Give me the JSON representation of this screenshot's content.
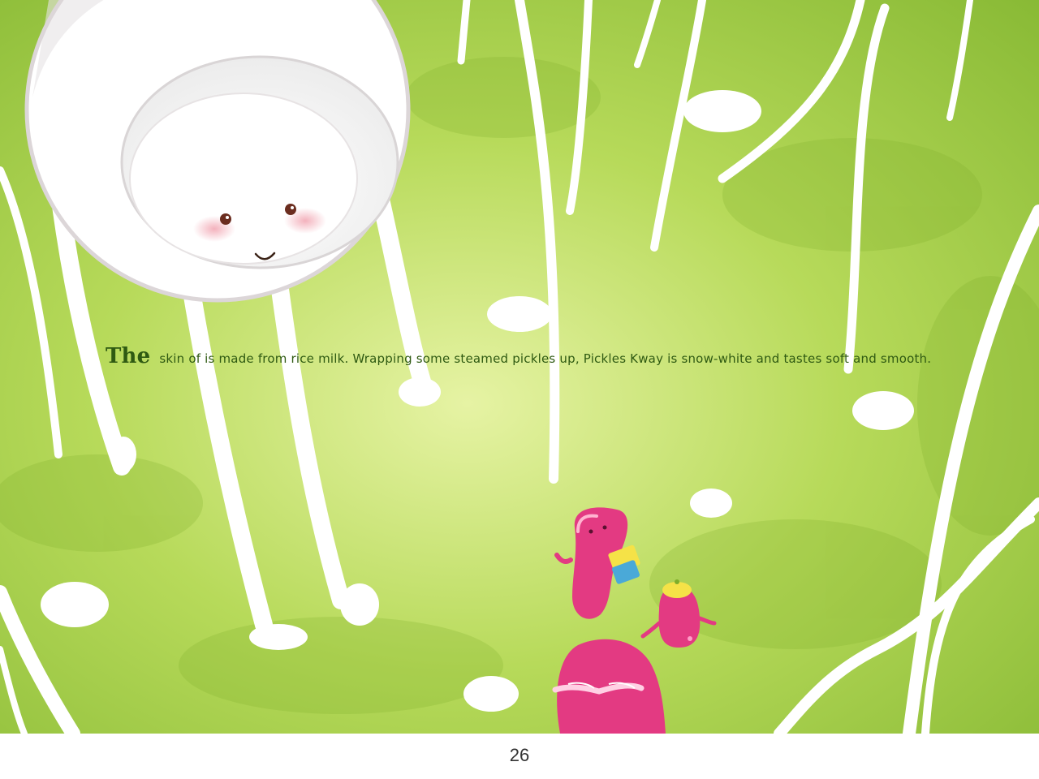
{
  "story": {
    "caption_first_word": "The",
    "caption_rest": "skin of is made from  rice milk. Wrapping some steamed pickles up, Pickles Kway is snow-white and tastes soft and smooth."
  },
  "footer": {
    "page_number": "26"
  },
  "colors": {
    "grass": "#a9d13f",
    "grass_dark": "#7fae2a",
    "caption_text": "#2f5a12",
    "characters": "#e33a82"
  }
}
